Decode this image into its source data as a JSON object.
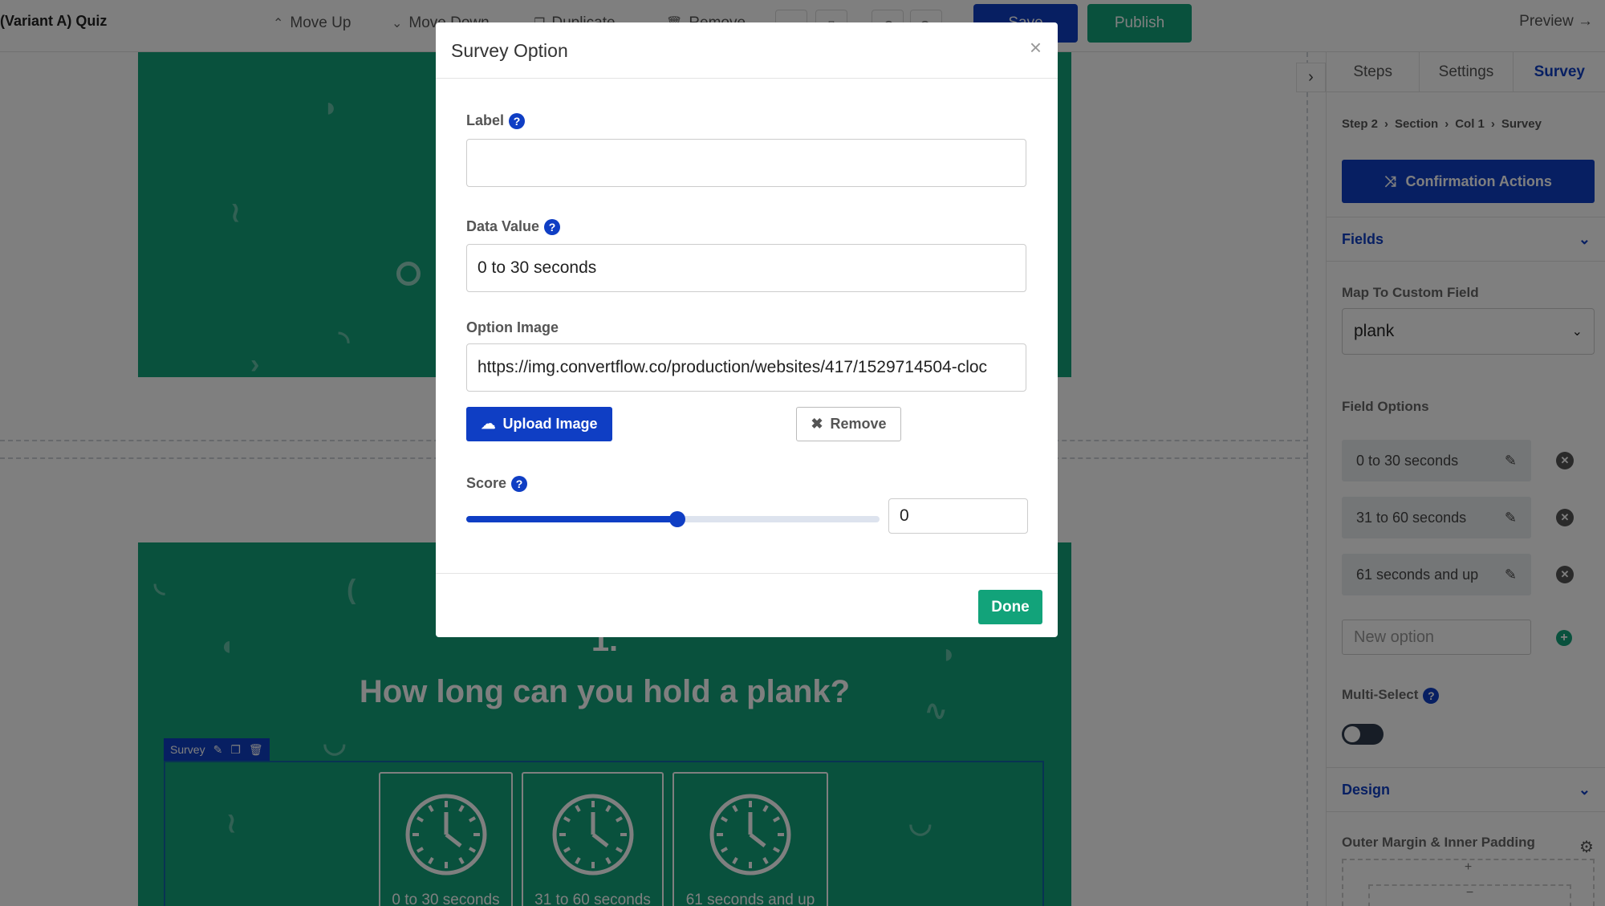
{
  "app": {
    "title": "(Variant A) Quiz"
  },
  "toolbar": {
    "move_up": "Move Up",
    "move_down": "Move Down",
    "duplicate": "Duplicate",
    "remove": "Remove",
    "save": "Save",
    "publish": "Publish",
    "preview": "Preview →"
  },
  "canvas": {
    "question_number": "1.",
    "question_title": "How long can you hold a plank?",
    "survey_tag": "Survey",
    "options": [
      "0 to 30 seconds",
      "31 to 60 seconds",
      "61 seconds and up"
    ]
  },
  "panel": {
    "tabs": [
      "Steps",
      "Settings",
      "Survey"
    ],
    "active_tab": "Survey",
    "breadcrumb": [
      "Step 2",
      "Section",
      "Col 1",
      "Survey"
    ],
    "confirm_actions": "Confirmation Actions",
    "fields_heading": "Fields",
    "map_label": "Map To Custom Field",
    "map_value": "plank",
    "field_options_label": "Field Options",
    "field_options": [
      "0 to 30 seconds",
      "31 to 60 seconds",
      "61 seconds and up"
    ],
    "new_option_placeholder": "New option",
    "multi_select_label": "Multi-Select",
    "multi_select_on": false,
    "design_heading": "Design",
    "margin_label": "Outer Margin & Inner Padding"
  },
  "modal": {
    "title": "Survey Option",
    "label_label": "Label",
    "label_value": "",
    "data_value_label": "Data Value",
    "data_value": "0 to 30 seconds",
    "option_image_label": "Option Image",
    "option_image_url": "https://img.convertflow.co/production/websites/417/1529714504-cloc",
    "upload_button": "Upload Image",
    "remove_button": "Remove",
    "score_label": "Score",
    "score_value": "0",
    "score_slider_fraction": 0.51,
    "done_button": "Done"
  },
  "colors": {
    "primary": "#0f3ec4",
    "success": "#12a37a",
    "canvas_green": "#12a37a"
  }
}
